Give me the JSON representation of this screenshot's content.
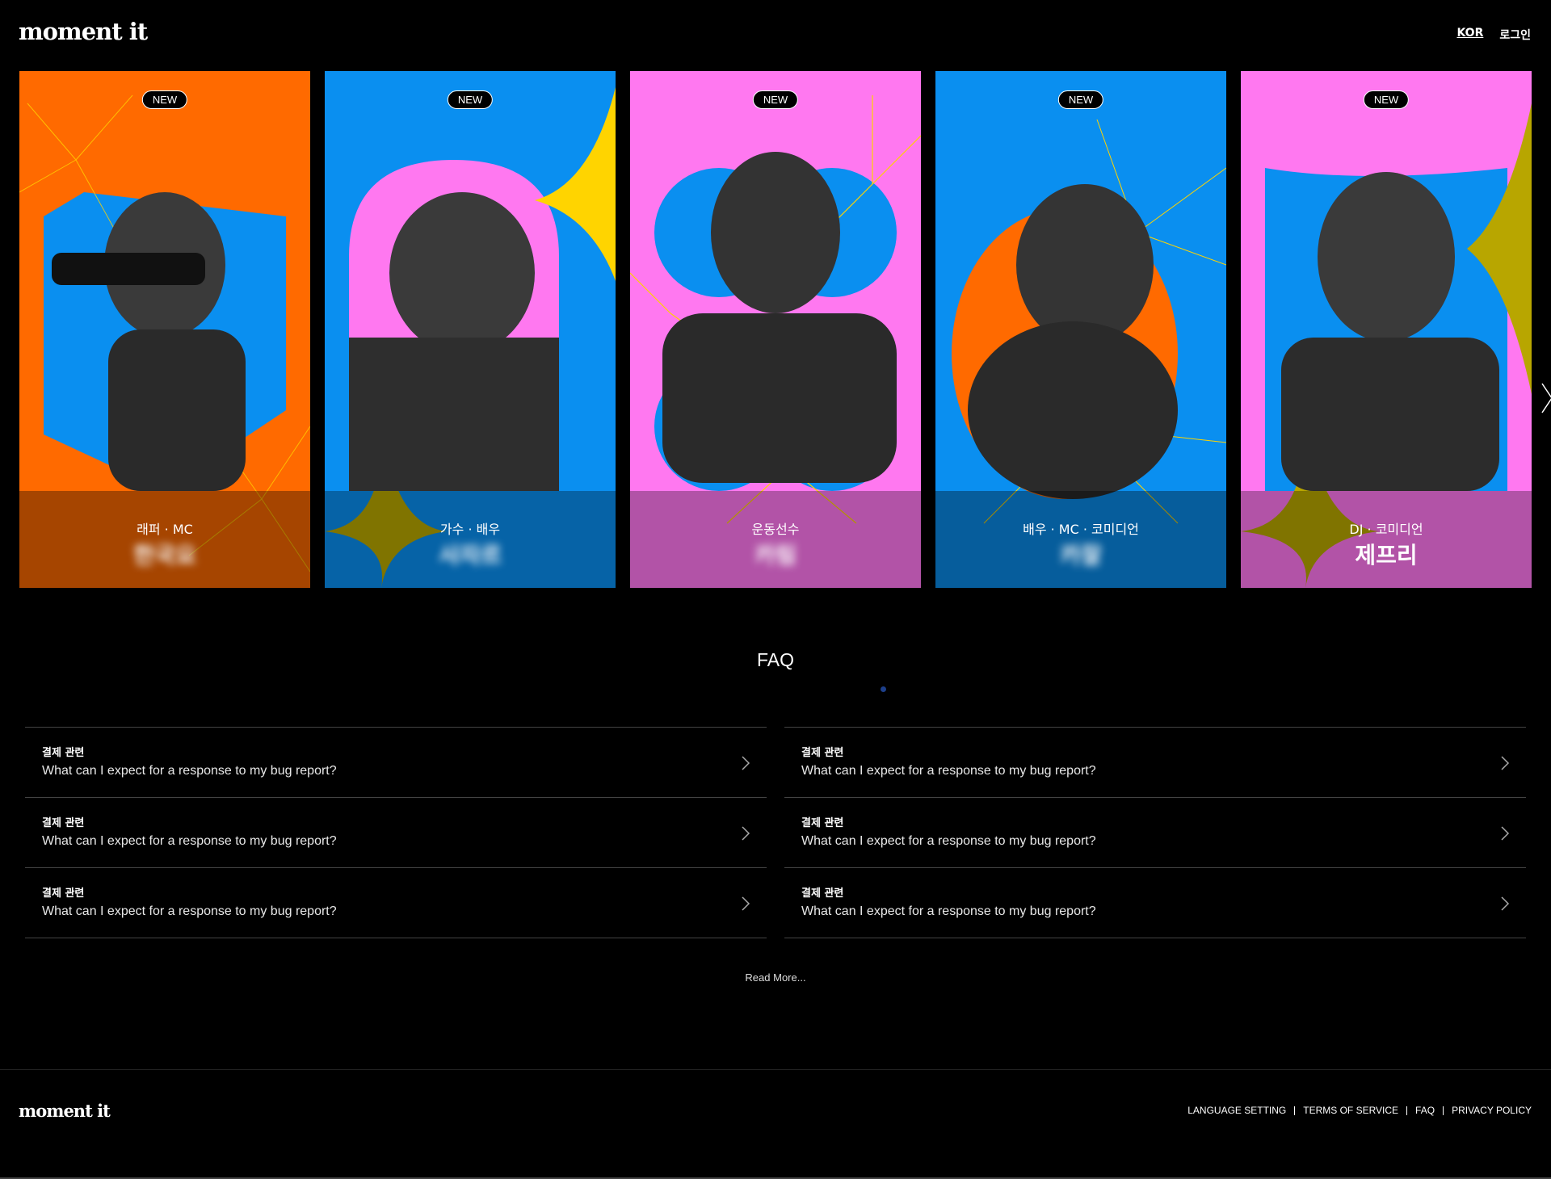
{
  "header": {
    "logo": "moment it",
    "lang": "KOR",
    "login": "로그인"
  },
  "cards": [
    {
      "badge": "NEW",
      "roles": "래퍼 · MC",
      "name": "한국요",
      "bg": "#ff6a00",
      "frame": "#0a8ff0"
    },
    {
      "badge": "NEW",
      "roles": "가수 · 배우",
      "name": "사자르",
      "bg": "#0a8ff0",
      "frame": "#ff78f0"
    },
    {
      "badge": "NEW",
      "roles": "운동선수",
      "name": "카림",
      "bg": "#ff78f0",
      "frame": "#0a8ff0"
    },
    {
      "badge": "NEW",
      "roles": "배우 · MC · 코미디언",
      "name": "카잘",
      "bg": "#0a8ff0",
      "frame": "#ff6a00"
    },
    {
      "badge": "NEW",
      "roles": "DJ · 코미디언",
      "name": "제프리",
      "bg": "#ff78f0",
      "frame": "#0a8ff0"
    }
  ],
  "faq": {
    "title": "FAQ",
    "left": [
      {
        "category": "결제 관련",
        "question": "What can I expect for a response to my bug report?"
      },
      {
        "category": "결제 관련",
        "question": "What can I expect for a response to my bug report?"
      },
      {
        "category": "결제 관련",
        "question": "What can I expect for a response to my bug report?"
      }
    ],
    "right": [
      {
        "category": "결제 관련",
        "question": "What can I expect for a response to my bug report?"
      },
      {
        "category": "결제 관련",
        "question": "What can I expect for a response to my bug report?"
      },
      {
        "category": "결제 관련",
        "question": "What can I expect for a response to my bug report?"
      }
    ],
    "read_more": "Read More..."
  },
  "footer": {
    "logo": "moment it",
    "links": [
      "LANGUAGE SETTING",
      "TERMS OF SERVICE",
      "FAQ",
      "PRIVACY POLICY"
    ]
  },
  "colors": {
    "orange": "#ff6a00",
    "blue": "#0a8ff0",
    "pink": "#ff78f0",
    "yellow": "#ffd400"
  }
}
